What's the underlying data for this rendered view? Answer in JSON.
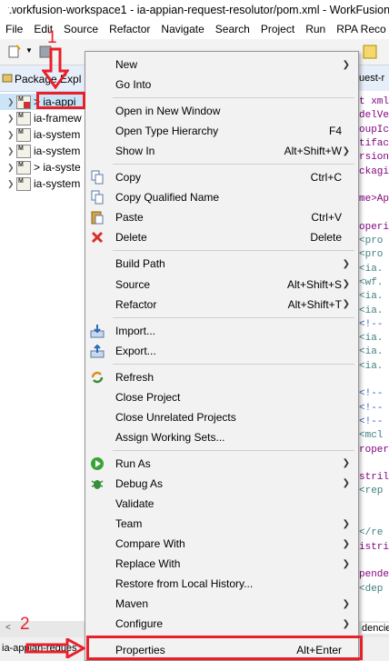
{
  "window": {
    "title": "workfusion-workspace1 - ia-appian-request-resolutor/pom.xml - WorkFusion"
  },
  "menubar": [
    "File",
    "Edit",
    "Source",
    "Refactor",
    "Navigate",
    "Search",
    "Project",
    "Run",
    "RPA Reco"
  ],
  "left_panel": {
    "tab_title": "Package Expl",
    "items": [
      {
        "label": "> ia-appi"
      },
      {
        "label": "ia-framew"
      },
      {
        "label": "ia-system"
      },
      {
        "label": "ia-system"
      },
      {
        "label": "> ia-syste"
      },
      {
        "label": "ia-system"
      }
    ]
  },
  "editor": {
    "tab_title": "uest-r",
    "lines": [
      "t xml",
      "delVe",
      "oupIc",
      "tifac",
      "rsion",
      "ckagi",
      "",
      "me>Ap",
      "",
      "operi",
      "<pro",
      "<pro",
      "<ia.",
      "<wf.",
      "<ia.",
      "<ia.",
      "<!--",
      "<ia.",
      "<ia.",
      "<ia.",
      "",
      "<!--",
      "<!--",
      "<!--",
      "<mcl",
      "roper",
      "",
      "stril",
      "<rep",
      "",
      "",
      "</re",
      "istri",
      "",
      "pende",
      "<dep"
    ]
  },
  "context_menu": {
    "items": [
      {
        "type": "item",
        "label": "New",
        "submenu": true
      },
      {
        "type": "item",
        "label": "Go Into"
      },
      {
        "type": "sep"
      },
      {
        "type": "item",
        "label": "Open in New Window"
      },
      {
        "type": "item",
        "label": "Open Type Hierarchy",
        "accel": "F4"
      },
      {
        "type": "item",
        "label": "Show In",
        "accel": "Alt+Shift+W",
        "submenu": true
      },
      {
        "type": "sep"
      },
      {
        "type": "item",
        "label": "Copy",
        "accel": "Ctrl+C",
        "icon": "copy-icon"
      },
      {
        "type": "item",
        "label": "Copy Qualified Name",
        "icon": "copy-qualified-icon"
      },
      {
        "type": "item",
        "label": "Paste",
        "accel": "Ctrl+V",
        "icon": "paste-icon"
      },
      {
        "type": "item",
        "label": "Delete",
        "accel": "Delete",
        "icon": "delete-icon"
      },
      {
        "type": "sep"
      },
      {
        "type": "item",
        "label": "Build Path",
        "submenu": true
      },
      {
        "type": "item",
        "label": "Source",
        "accel": "Alt+Shift+S",
        "submenu": true
      },
      {
        "type": "item",
        "label": "Refactor",
        "accel": "Alt+Shift+T",
        "submenu": true
      },
      {
        "type": "sep"
      },
      {
        "type": "item",
        "label": "Import...",
        "icon": "import-icon"
      },
      {
        "type": "item",
        "label": "Export...",
        "icon": "export-icon"
      },
      {
        "type": "sep"
      },
      {
        "type": "item",
        "label": "Refresh",
        "icon": "refresh-icon"
      },
      {
        "type": "item",
        "label": "Close Project"
      },
      {
        "type": "item",
        "label": "Close Unrelated Projects"
      },
      {
        "type": "item",
        "label": "Assign Working Sets..."
      },
      {
        "type": "sep"
      },
      {
        "type": "item",
        "label": "Run As",
        "submenu": true,
        "icon": "run-icon"
      },
      {
        "type": "item",
        "label": "Debug As",
        "submenu": true,
        "icon": "debug-icon"
      },
      {
        "type": "item",
        "label": "Validate"
      },
      {
        "type": "item",
        "label": "Team",
        "submenu": true
      },
      {
        "type": "item",
        "label": "Compare With",
        "submenu": true
      },
      {
        "type": "item",
        "label": "Replace With",
        "submenu": true
      },
      {
        "type": "item",
        "label": "Restore from Local History..."
      },
      {
        "type": "item",
        "label": "Maven",
        "submenu": true
      },
      {
        "type": "item",
        "label": "Configure",
        "submenu": true
      },
      {
        "type": "sep"
      },
      {
        "type": "item",
        "label": "Properties",
        "accel": "Alt+Enter"
      }
    ]
  },
  "annotations": {
    "step1": "1",
    "step2": "2"
  },
  "status": {
    "left_text": "ia-appian-reques",
    "right_text": "dencie"
  },
  "colors": {
    "annotation": "#e8202a",
    "menu_bg": "#f2f2f2",
    "selection": "#cce4f7"
  }
}
